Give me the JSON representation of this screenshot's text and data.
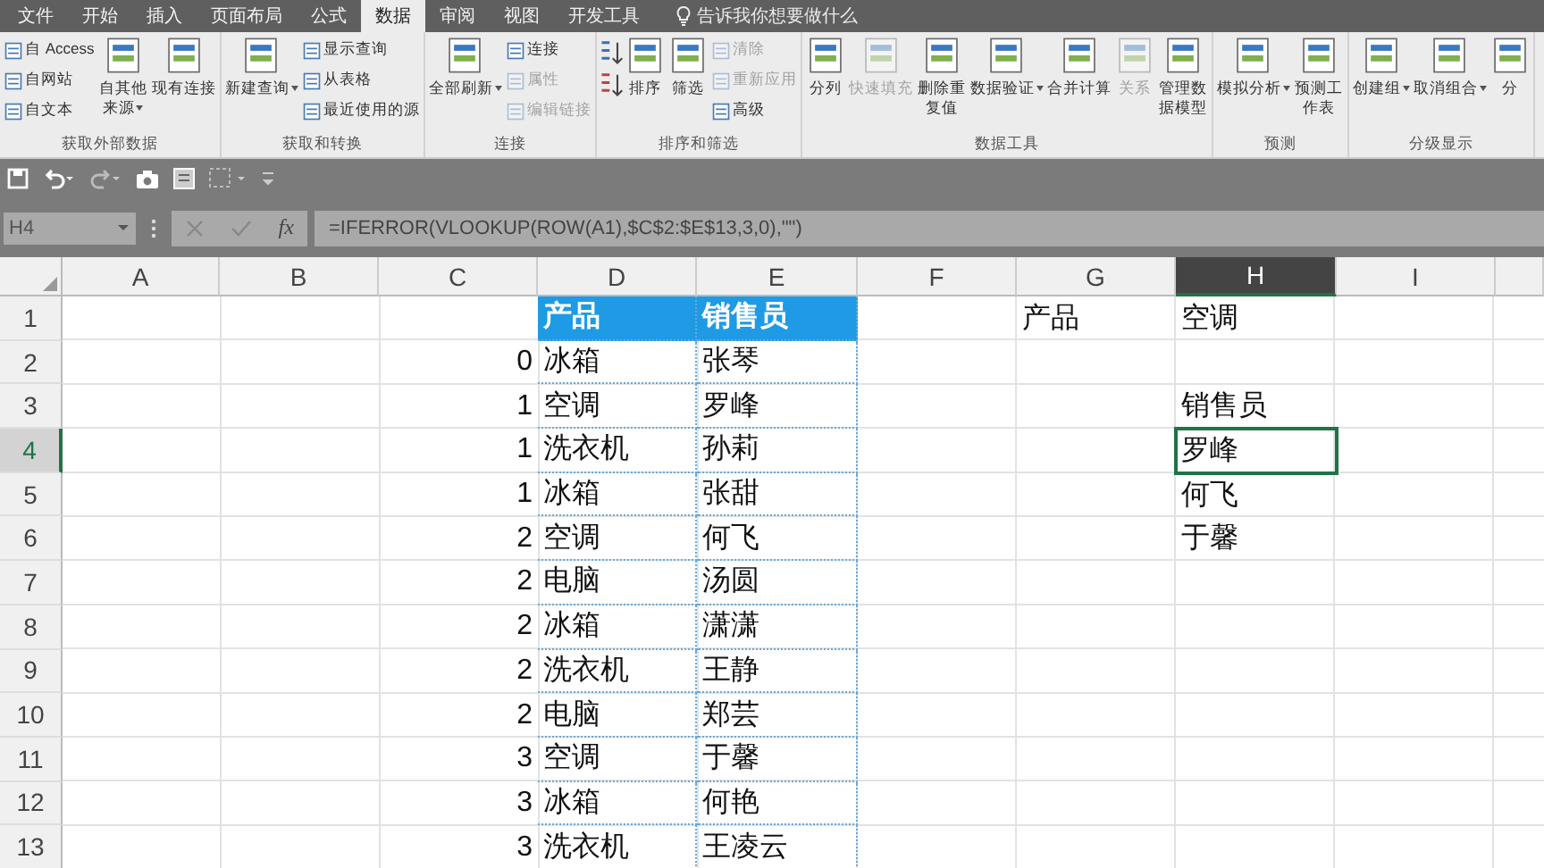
{
  "tabs": [
    {
      "label": "文件",
      "selected": false
    },
    {
      "label": "开始",
      "selected": false
    },
    {
      "label": "插入",
      "selected": false
    },
    {
      "label": "页面布局",
      "selected": false
    },
    {
      "label": "公式",
      "selected": false
    },
    {
      "label": "数据",
      "selected": true
    },
    {
      "label": "审阅",
      "selected": false
    },
    {
      "label": "视图",
      "selected": false
    },
    {
      "label": "开发工具",
      "selected": false
    }
  ],
  "tell_me": {
    "placeholder": "告诉我你想要做什么"
  },
  "ribbon_groups": [
    {
      "label": "获取外部数据",
      "items": [
        {
          "kind": "small",
          "label": "自 Access",
          "disabled": false
        },
        {
          "kind": "small",
          "label": "自网站",
          "disabled": false
        },
        {
          "kind": "small",
          "label": "自文本",
          "disabled": false
        },
        {
          "kind": "large",
          "label": "自其他来源",
          "disabled": false,
          "dropdown": true
        },
        {
          "kind": "large",
          "label": "现有连接",
          "disabled": false,
          "dropdown": false
        }
      ]
    },
    {
      "label": "获取和转换",
      "items": [
        {
          "kind": "large",
          "label": "新建查询",
          "disabled": false,
          "dropdown": true
        },
        {
          "kind": "small",
          "label": "显示查询",
          "disabled": false
        },
        {
          "kind": "small",
          "label": "从表格",
          "disabled": false
        },
        {
          "kind": "small",
          "label": "最近使用的源",
          "disabled": false
        }
      ]
    },
    {
      "label": "连接",
      "items": [
        {
          "kind": "large",
          "label": "全部刷新",
          "disabled": false,
          "dropdown": true
        },
        {
          "kind": "small",
          "label": "连接",
          "disabled": false
        },
        {
          "kind": "small",
          "label": "属性",
          "disabled": true
        },
        {
          "kind": "small",
          "label": "编辑链接",
          "disabled": true
        }
      ]
    },
    {
      "label": "排序和筛选",
      "items": [
        {
          "kind": "sort"
        },
        {
          "kind": "large",
          "label": "排序",
          "disabled": false,
          "dropdown": false
        },
        {
          "kind": "large",
          "label": "筛选",
          "disabled": false,
          "dropdown": false
        },
        {
          "kind": "small",
          "label": "清除",
          "disabled": true
        },
        {
          "kind": "small",
          "label": "重新应用",
          "disabled": true
        },
        {
          "kind": "small",
          "label": "高级",
          "disabled": false
        }
      ]
    },
    {
      "label": "数据工具",
      "items": [
        {
          "kind": "large",
          "label": "分列",
          "disabled": false,
          "dropdown": false
        },
        {
          "kind": "large",
          "label": "快速填充",
          "disabled": true,
          "dropdown": false
        },
        {
          "kind": "large",
          "label": "删除重复值",
          "disabled": false,
          "dropdown": false
        },
        {
          "kind": "large",
          "label": "数据验证",
          "disabled": false,
          "dropdown": true
        },
        {
          "kind": "large",
          "label": "合并计算",
          "disabled": false,
          "dropdown": false
        },
        {
          "kind": "large",
          "label": "关系",
          "disabled": true,
          "dropdown": false
        },
        {
          "kind": "large",
          "label": "管理数据模型",
          "disabled": false,
          "dropdown": false
        }
      ]
    },
    {
      "label": "预测",
      "items": [
        {
          "kind": "large",
          "label": "模拟分析",
          "disabled": false,
          "dropdown": true
        },
        {
          "kind": "large",
          "label": "预测工作表",
          "disabled": false,
          "dropdown": false
        }
      ]
    },
    {
      "label": "分级显示",
      "items": [
        {
          "kind": "large",
          "label": "创建组",
          "disabled": false,
          "dropdown": true
        },
        {
          "kind": "large",
          "label": "取消组合",
          "disabled": false,
          "dropdown": true
        },
        {
          "kind": "large",
          "label": "分",
          "disabled": false,
          "dropdown": false
        }
      ]
    }
  ],
  "formula_bar": {
    "name_box": "H4",
    "function_label": "fx",
    "formula": "=IFERROR(VLOOKUP(ROW(A1),$C$2:$E$13,3,0),\"\")"
  },
  "columns": [
    {
      "label": "A",
      "selected": false
    },
    {
      "label": "B",
      "selected": false
    },
    {
      "label": "C",
      "selected": false
    },
    {
      "label": "D",
      "selected": false
    },
    {
      "label": "E",
      "selected": false
    },
    {
      "label": "F",
      "selected": false
    },
    {
      "label": "G",
      "selected": false
    },
    {
      "label": "H",
      "selected": true
    },
    {
      "label": "I",
      "selected": false
    }
  ],
  "rows": [
    {
      "label": "1",
      "selected": false,
      "cells": {
        "d": {
          "text": "产品",
          "kind": "text",
          "filled": true,
          "selected": false
        },
        "e": {
          "text": "销售员",
          "kind": "text",
          "filled": true,
          "selected": false
        },
        "g": {
          "text": "产品",
          "kind": "text",
          "filled": false,
          "selected": false
        },
        "h": {
          "text": "空调",
          "kind": "text",
          "filled": false,
          "selected": false
        }
      }
    },
    {
      "label": "2",
      "selected": false,
      "cells": {
        "c": {
          "text": "0",
          "kind": "number",
          "filled": false,
          "selected": false
        },
        "d": {
          "text": "冰箱",
          "kind": "text",
          "filled": false,
          "selected": false
        },
        "e": {
          "text": "张琴",
          "kind": "text",
          "filled": false,
          "selected": false
        }
      }
    },
    {
      "label": "3",
      "selected": false,
      "cells": {
        "c": {
          "text": "1",
          "kind": "number",
          "filled": false,
          "selected": false
        },
        "d": {
          "text": "空调",
          "kind": "text",
          "filled": false,
          "selected": false
        },
        "e": {
          "text": "罗峰",
          "kind": "text",
          "filled": false,
          "selected": false
        },
        "h": {
          "text": "销售员",
          "kind": "text",
          "filled": false,
          "selected": false
        }
      }
    },
    {
      "label": "4",
      "selected": true,
      "cells": {
        "c": {
          "text": "1",
          "kind": "number",
          "filled": false,
          "selected": false
        },
        "d": {
          "text": "洗衣机",
          "kind": "text",
          "filled": false,
          "selected": false
        },
        "e": {
          "text": "孙莉",
          "kind": "text",
          "filled": false,
          "selected": false
        },
        "h": {
          "text": "罗峰",
          "kind": "text",
          "filled": false,
          "selected": true
        }
      }
    },
    {
      "label": "5",
      "selected": false,
      "cells": {
        "c": {
          "text": "1",
          "kind": "number",
          "filled": false,
          "selected": false
        },
        "d": {
          "text": "冰箱",
          "kind": "text",
          "filled": false,
          "selected": false
        },
        "e": {
          "text": "张甜",
          "kind": "text",
          "filled": false,
          "selected": false
        },
        "h": {
          "text": "何飞",
          "kind": "text",
          "filled": false,
          "selected": false
        }
      }
    },
    {
      "label": "6",
      "selected": false,
      "cells": {
        "c": {
          "text": "2",
          "kind": "number",
          "filled": false,
          "selected": false
        },
        "d": {
          "text": "空调",
          "kind": "text",
          "filled": false,
          "selected": false
        },
        "e": {
          "text": "何飞",
          "kind": "text",
          "filled": false,
          "selected": false
        },
        "h": {
          "text": "于馨",
          "kind": "text",
          "filled": false,
          "selected": false
        }
      }
    },
    {
      "label": "7",
      "selected": false,
      "cells": {
        "c": {
          "text": "2",
          "kind": "number",
          "filled": false,
          "selected": false
        },
        "d": {
          "text": "电脑",
          "kind": "text",
          "filled": false,
          "selected": false
        },
        "e": {
          "text": "汤圆",
          "kind": "text",
          "filled": false,
          "selected": false
        }
      }
    },
    {
      "label": "8",
      "selected": false,
      "cells": {
        "c": {
          "text": "2",
          "kind": "number",
          "filled": false,
          "selected": false
        },
        "d": {
          "text": "冰箱",
          "kind": "text",
          "filled": false,
          "selected": false
        },
        "e": {
          "text": "潇潇",
          "kind": "text",
          "filled": false,
          "selected": false
        }
      }
    },
    {
      "label": "9",
      "selected": false,
      "cells": {
        "c": {
          "text": "2",
          "kind": "number",
          "filled": false,
          "selected": false
        },
        "d": {
          "text": "洗衣机",
          "kind": "text",
          "filled": false,
          "selected": false
        },
        "e": {
          "text": "王静",
          "kind": "text",
          "filled": false,
          "selected": false
        }
      }
    },
    {
      "label": "10",
      "selected": false,
      "cells": {
        "c": {
          "text": "2",
          "kind": "number",
          "filled": false,
          "selected": false
        },
        "d": {
          "text": "电脑",
          "kind": "text",
          "filled": false,
          "selected": false
        },
        "e": {
          "text": "郑芸",
          "kind": "text",
          "filled": false,
          "selected": false
        }
      }
    },
    {
      "label": "11",
      "selected": false,
      "cells": {
        "c": {
          "text": "3",
          "kind": "number",
          "filled": false,
          "selected": false
        },
        "d": {
          "text": "空调",
          "kind": "text",
          "filled": false,
          "selected": false
        },
        "e": {
          "text": "于馨",
          "kind": "text",
          "filled": false,
          "selected": false
        }
      }
    },
    {
      "label": "12",
      "selected": false,
      "cells": {
        "c": {
          "text": "3",
          "kind": "number",
          "filled": false,
          "selected": false
        },
        "d": {
          "text": "冰箱",
          "kind": "text",
          "filled": false,
          "selected": false
        },
        "e": {
          "text": "何艳",
          "kind": "text",
          "filled": false,
          "selected": false
        }
      }
    },
    {
      "label": "13",
      "selected": false,
      "cells": {
        "c": {
          "text": "3",
          "kind": "number",
          "filled": false,
          "selected": false
        },
        "d": {
          "text": "洗衣机",
          "kind": "text",
          "filled": false,
          "selected": false
        },
        "e": {
          "text": "王凌云",
          "kind": "text",
          "filled": false,
          "selected": false
        }
      }
    }
  ]
}
